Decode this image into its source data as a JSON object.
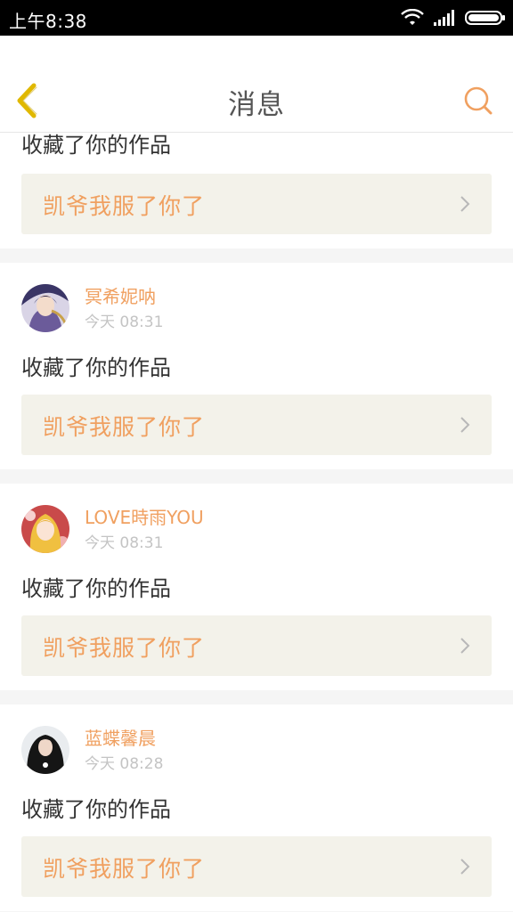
{
  "status_bar": {
    "time": "上午8:38"
  },
  "header": {
    "title": "消息",
    "back_icon": "chevron-left-icon",
    "search_icon": "search-icon"
  },
  "colors": {
    "accent": "#f0a060",
    "card_bg": "#f3f2ea",
    "back_icon": "#e8c400"
  },
  "partial_item": {
    "action": "收藏了你的作品",
    "work_title": "凯爷我服了你了"
  },
  "items": [
    {
      "username": "冥希妮呐",
      "time": "今天 08:31",
      "action": "收藏了你的作品",
      "work_title": "凯爷我服了你了"
    },
    {
      "username": "LOVE時雨YOU",
      "time": "今天 08:31",
      "action": "收藏了你的作品",
      "work_title": "凯爷我服了你了"
    },
    {
      "username": "蓝蝶馨晨",
      "time": "今天 08:28",
      "action": "收藏了你的作品",
      "work_title": "凯爷我服了你了"
    }
  ]
}
